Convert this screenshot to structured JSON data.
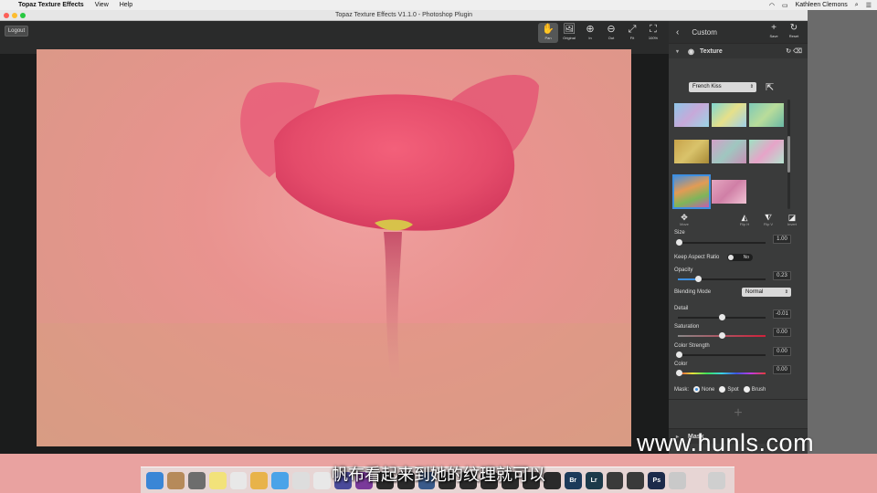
{
  "menubar": {
    "app_name": "Topaz Texture Effects",
    "items": [
      "View",
      "Help"
    ],
    "user": "Kathleen Clemons"
  },
  "window": {
    "title": "Topaz Texture Effects V1.1.0 - Photoshop Plugin"
  },
  "toolbar": {
    "logout_label": "Logout",
    "tools": [
      {
        "name": "pan",
        "label": "Pan",
        "glyph": "✋",
        "active": true
      },
      {
        "name": "original",
        "label": "Original",
        "glyph": "🖼",
        "active": false
      },
      {
        "name": "zoom-in",
        "label": "In",
        "glyph": "⊕",
        "active": false
      },
      {
        "name": "zoom-out",
        "label": "Out",
        "glyph": "⊖",
        "active": false
      },
      {
        "name": "fit",
        "label": "Fit",
        "glyph": "⤢",
        "active": false
      },
      {
        "name": "100",
        "label": "100%",
        "glyph": "⛶",
        "active": false
      }
    ]
  },
  "panel": {
    "header_title": "Custom",
    "save_label": "Save",
    "reset_label": "Reset",
    "texture_section": "Texture",
    "preset": "French Kiss",
    "transform": [
      {
        "name": "move",
        "label": "Move",
        "glyph": "✥"
      },
      {
        "name": "flip-h",
        "label": "Flip H",
        "glyph": "◭"
      },
      {
        "name": "flip-v",
        "label": "Flip V",
        "glyph": "⧨"
      },
      {
        "name": "invert",
        "label": "Invert",
        "glyph": "◪"
      }
    ],
    "size_label": "Size",
    "size_value": "1.00",
    "keep_aspect_label": "Keep Aspect Ratio",
    "keep_aspect_value": "No",
    "opacity_label": "Opacity",
    "opacity_value": "0.23",
    "blending_label": "Blending Mode",
    "blending_value": "Normal",
    "detail_label": "Detail",
    "detail_value": "-0.01",
    "saturation_label": "Saturation",
    "saturation_value": "0.00",
    "color_strength_label": "Color Strength",
    "color_strength_value": "0.00",
    "color_label": "Color",
    "color_value": "0.00",
    "mask_label": "Mask:",
    "mask_options": [
      "None",
      "Spot",
      "Brush"
    ],
    "mask_section": "Mask"
  },
  "watermark": "www.hunls.com",
  "subtitle": "帆布看起来到她的纹理就可以"
}
